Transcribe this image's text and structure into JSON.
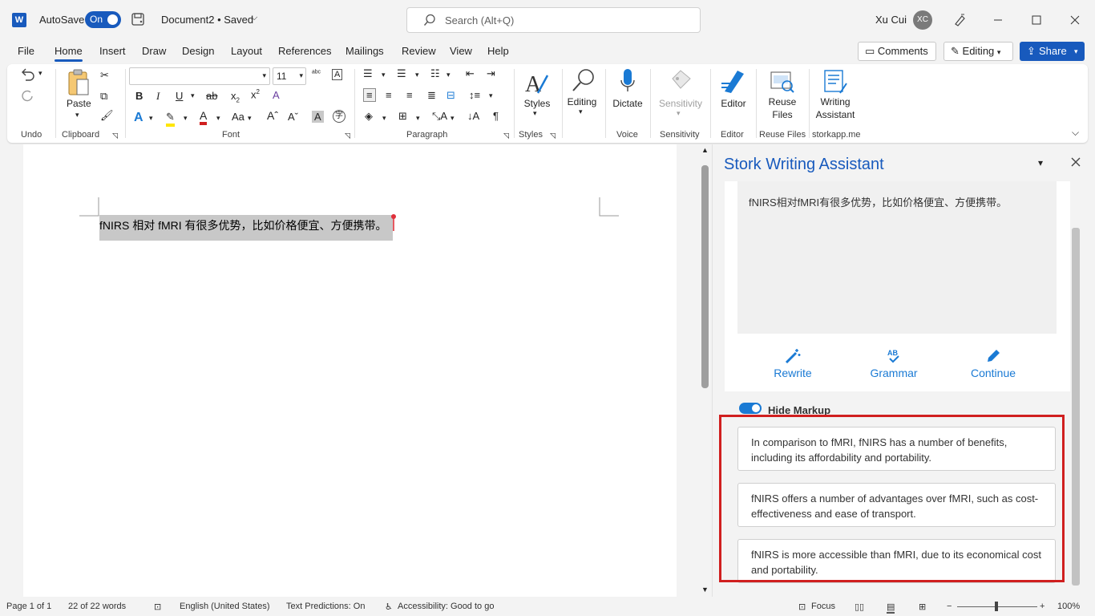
{
  "titlebar": {
    "autosave_label": "AutoSave",
    "autosave_state": "On",
    "doc_title": "Document2 • Saved",
    "search_placeholder": "Search (Alt+Q)",
    "user_name": "Xu Cui",
    "user_initials": "XC"
  },
  "menu": {
    "tabs": [
      "File",
      "Home",
      "Insert",
      "Draw",
      "Design",
      "Layout",
      "References",
      "Mailings",
      "Review",
      "View",
      "Help"
    ],
    "active": "Home",
    "comments_label": "Comments",
    "editing_label": "Editing",
    "share_label": "Share"
  },
  "ribbon": {
    "groups": {
      "undo": "Undo",
      "clipboard": "Clipboard",
      "font": "Font",
      "paragraph": "Paragraph",
      "styles": "Styles",
      "voice": "Voice",
      "sensitivity": "Sensitivity",
      "editor": "Editor",
      "reuse_files": "Reuse Files",
      "storkapp": "storkapp.me"
    },
    "paste_label": "Paste",
    "font_size": "11",
    "styles_label": "Styles",
    "editing_label": "Editing",
    "dictate_label": "Dictate",
    "sensitivity_label": "Sensitivity",
    "editor_label": "Editor",
    "reuse_files_label_1": "Reuse",
    "reuse_files_label_2": "Files",
    "writing_assistant_label_1": "Writing",
    "writing_assistant_label_2": "Assistant"
  },
  "document": {
    "selected_text": "fNIRS 相对 fMRI 有很多优势，比如价格便宜、方便携带。"
  },
  "pane": {
    "title": "Stork Writing Assistant",
    "input_text": "fNIRS相对fMRI有很多优势，比如价格便宜、方便携带。",
    "actions": {
      "rewrite": "Rewrite",
      "grammar": "Grammar",
      "continue": "Continue"
    },
    "hide_markup_label": "Hide Markup",
    "suggestions": [
      "In comparison to fMRI, fNIRS has a number of benefits, including its affordability and portability.",
      "fNIRS offers a number of advantages over fMRI, such as cost-effectiveness and ease of transport.",
      "fNIRS is more accessible than fMRI, due to its economical cost and portability."
    ]
  },
  "status": {
    "page": "Page 1 of 1",
    "words": "22 of 22 words",
    "language": "English (United States)",
    "predictions": "Text Predictions: On",
    "accessibility": "Accessibility: Good to go",
    "focus": "Focus",
    "zoom": "100%"
  },
  "colors": {
    "accent": "#185abd",
    "pane_accent": "#1a7ad4",
    "highlight_frame": "#d01f1f"
  }
}
